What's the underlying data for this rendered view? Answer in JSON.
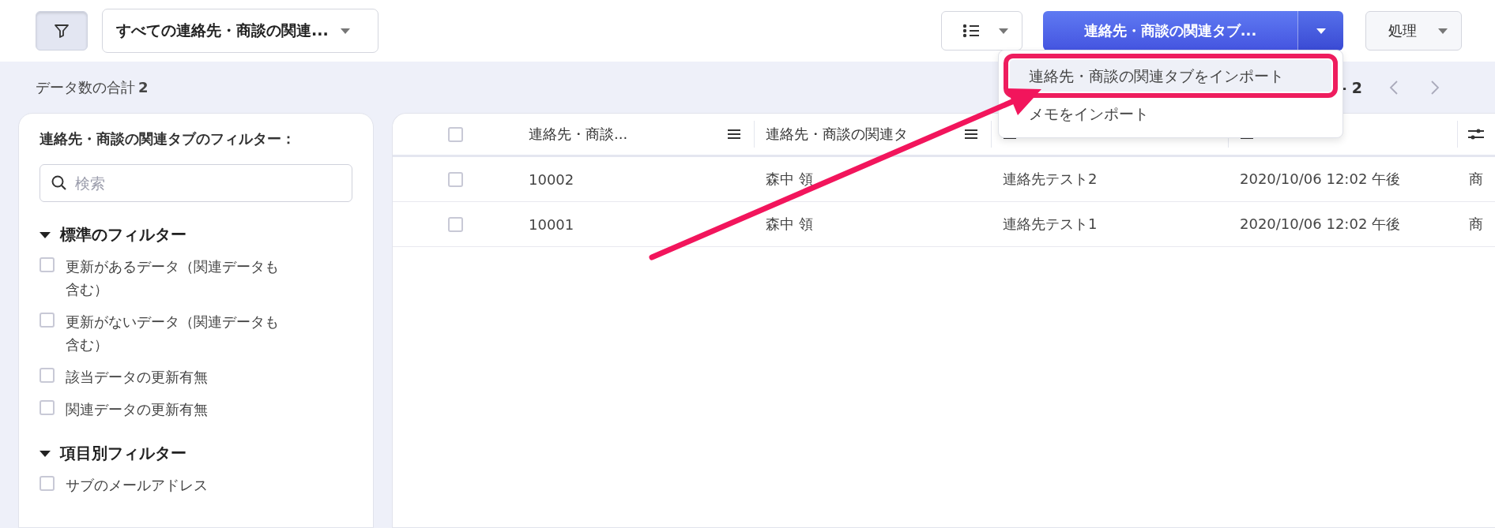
{
  "toolbar": {
    "filter_button": {
      "pressed": true
    },
    "view_select": {
      "value": "すべての連絡先・商談の関連..."
    },
    "primary_button": {
      "label": "連絡先・商談の関連タブ...",
      "expanded": true
    },
    "process_button": {
      "label": "処理"
    }
  },
  "menu": [
    {
      "label": "連絡先・商談の関連タブをインポート",
      "selected": true,
      "outlined": true
    },
    {
      "label": "メモをインポート",
      "selected": false,
      "outlined": false
    }
  ],
  "summary": {
    "label": "データ数の合計",
    "count": "2"
  },
  "pagination": {
    "range": "- 2"
  },
  "filter_panel": {
    "title": "連絡先・商談の関連タブのフィルター：",
    "search": {
      "placeholder": "検索"
    },
    "sections": [
      {
        "title": "標準のフィルター",
        "expanded": true,
        "items": [
          {
            "label": "更新があるデータ（関連データも含む）",
            "checked": false
          },
          {
            "label": "更新がないデータ（関連データも含む）",
            "checked": false
          },
          {
            "label": "該当データの更新有無",
            "checked": false
          },
          {
            "label": "関連データの更新有無",
            "checked": false
          }
        ]
      },
      {
        "title": "項目別フィルター",
        "expanded": true,
        "items": [
          {
            "label": "サブのメールアドレス",
            "checked": false
          }
        ]
      }
    ]
  },
  "table": {
    "select_all": {
      "checked": false
    },
    "columns": [
      {
        "label": "連絡先・商談..."
      },
      {
        "label": "連絡先・商談の関連タ"
      },
      {
        "covered": true
      },
      {
        "covered": true
      }
    ],
    "rows": [
      {
        "checked": false,
        "cells": [
          "10002",
          "森中 領",
          "連絡先テスト2",
          "2020/10/06 12:02 午後",
          "商"
        ]
      },
      {
        "checked": false,
        "cells": [
          "10001",
          "森中 領",
          "連絡先テスト1",
          "2020/10/06 12:02 午後",
          "商"
        ]
      }
    ]
  },
  "annotations": [
    {
      "kind": "arrow"
    }
  ]
}
